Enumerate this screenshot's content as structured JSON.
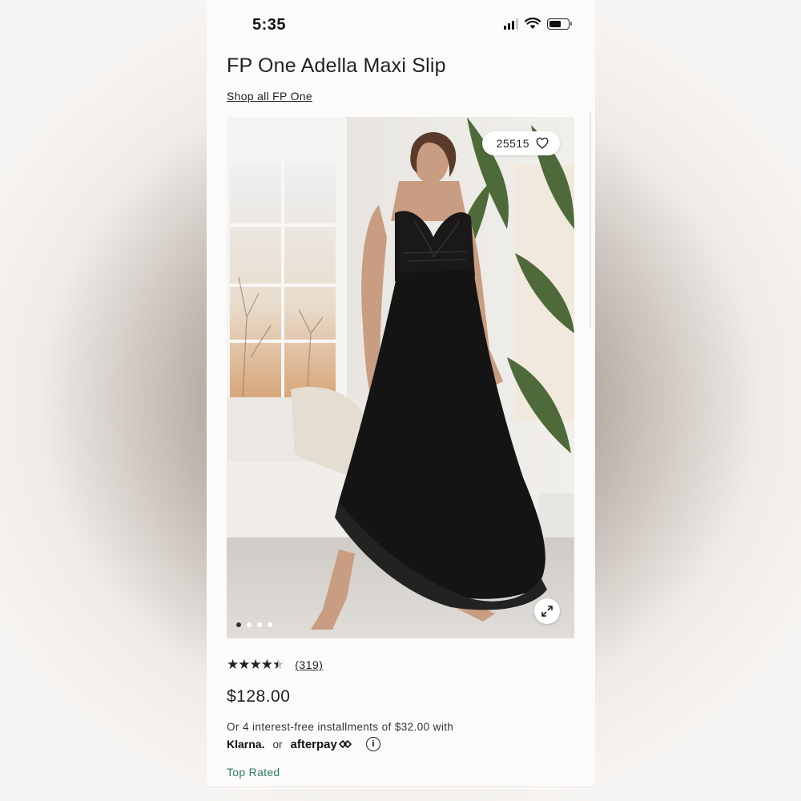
{
  "status_bar": {
    "time": "5:35"
  },
  "product": {
    "title": "FP One Adella Maxi Slip",
    "shop_link": "Shop all FP One",
    "likes": "25515",
    "rating_value": 4.5,
    "rating_max": 5,
    "reviews": "(319)",
    "price": "$128.00",
    "installments_text": "Or 4 interest-free installments of $32.00 with",
    "klarna": "Klarna.",
    "or_text": "or",
    "afterpay": "afterpay",
    "badge": "Top Rated"
  },
  "gallery": {
    "image_count": 4,
    "active_index": 0
  },
  "icons": {
    "heart": "heart-icon",
    "expand": "expand-icon",
    "info": "info-icon",
    "wifi": "wifi-icon",
    "signal": "signal-icon",
    "battery": "battery-icon"
  },
  "colors": {
    "accent_green": "#2f7a5f",
    "text": "#222222"
  }
}
